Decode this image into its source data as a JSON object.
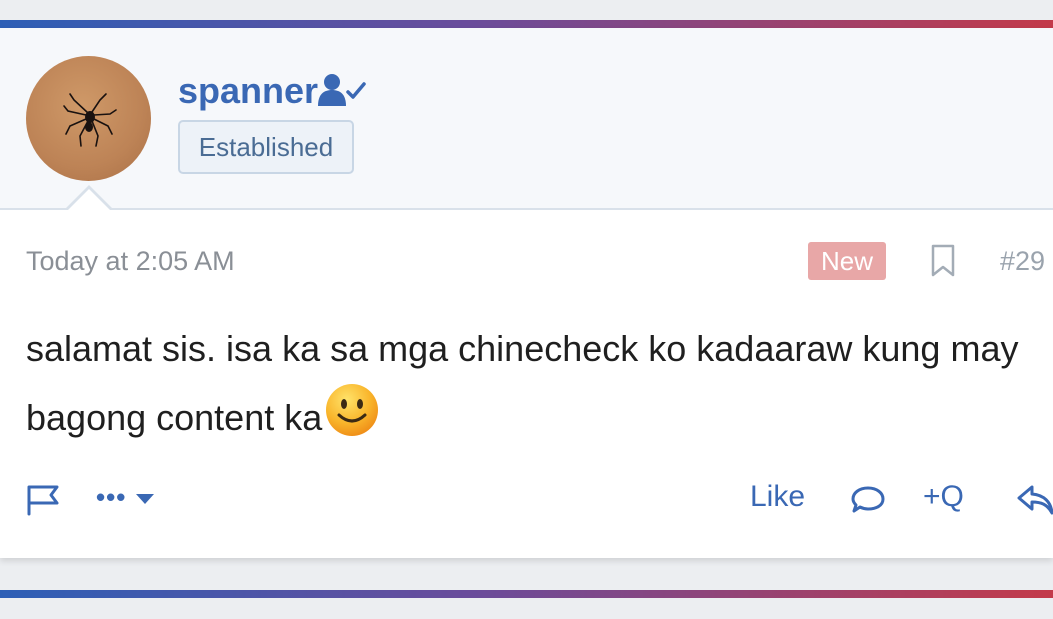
{
  "user": {
    "name": "spanner",
    "title": "Established"
  },
  "post": {
    "timestamp": "Today at 2:05 AM",
    "new_label": "New",
    "number": "#29",
    "body": "salamat sis. isa ka sa mga chinecheck ko kadaaraw kung may bagong content ka"
  },
  "actions": {
    "more_label": "•••",
    "like_label": "Like",
    "multiquote_label": "+Q"
  },
  "icons": {
    "verified_user": "user-check-icon",
    "bookmark": "bookmark-icon",
    "report": "flag-icon",
    "dropdown": "caret-down-icon",
    "reply": "speech-bubble-icon",
    "share": "reply-arrow-icon",
    "emoji": "smiley-face-icon"
  },
  "colors": {
    "accent": "#3a68b4",
    "new_badge": "#e8a7a7",
    "badge_bg": "#edf2f8"
  }
}
